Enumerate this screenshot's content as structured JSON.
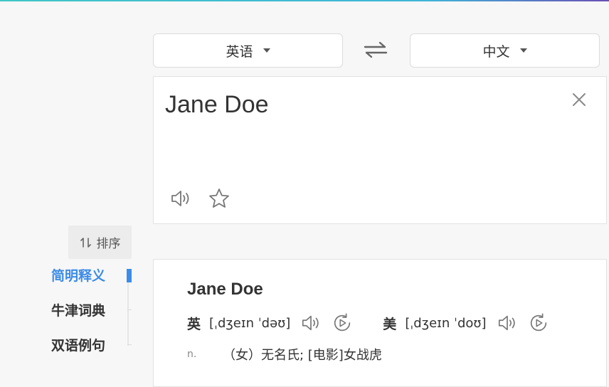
{
  "lang": {
    "source_label": "英语",
    "target_label": "中文"
  },
  "input": {
    "text": "Jane Doe"
  },
  "sort": {
    "label": "排序"
  },
  "nav": {
    "items": [
      {
        "label": "简明释义"
      },
      {
        "label": "牛津词典"
      },
      {
        "label": "双语例句"
      }
    ]
  },
  "result": {
    "word": "Jane Doe",
    "uk_label": "英",
    "uk_phonetic": "[ˌdʒeɪn ˈdəʊ]",
    "us_label": "美",
    "us_phonetic": "[ˌdʒeɪn ˈdoʊ]",
    "pos": "n.",
    "meaning": "（女）无名氏;  [电影]女战虎"
  },
  "colors": {
    "accent": "#3c8ce7",
    "text": "#333333",
    "muted": "#888888",
    "background": "#f7f7f7"
  },
  "icons": [
    "chevron-down-icon",
    "swap-icon",
    "close-icon",
    "speaker-icon",
    "star-icon",
    "sort-icon",
    "replay-icon"
  ]
}
